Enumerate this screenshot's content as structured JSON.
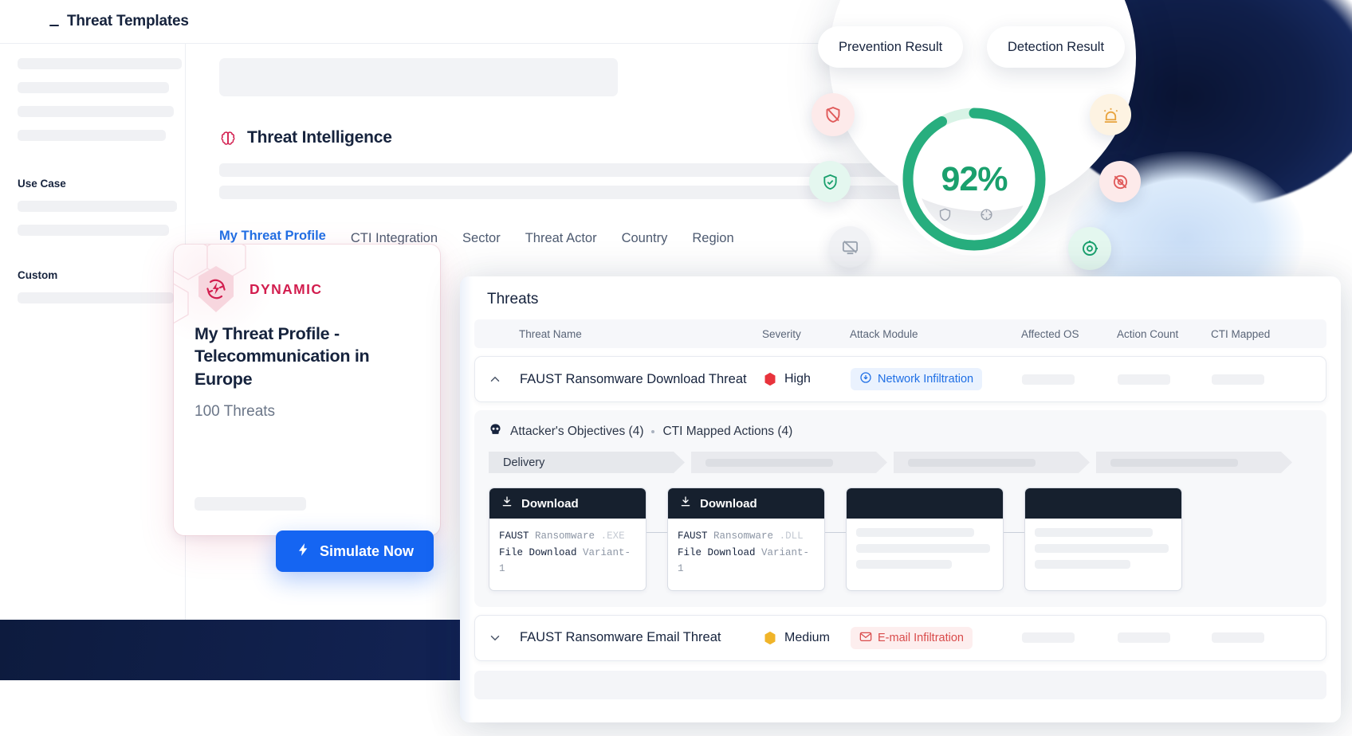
{
  "header": {
    "title": "Threat Templates"
  },
  "sidebar": {
    "sections": [
      {
        "label": "Use Case"
      },
      {
        "label": "Custom"
      }
    ]
  },
  "main": {
    "section_title": "Threat Intelligence",
    "section_icon": "brain-icon",
    "tabs": [
      {
        "label": "My Threat Profile",
        "active": true
      },
      {
        "label": "CTI Integration",
        "active": false
      },
      {
        "label": "Sector",
        "active": false
      },
      {
        "label": "Threat Actor",
        "active": false
      },
      {
        "label": "Country",
        "active": false
      },
      {
        "label": "Region",
        "active": false
      }
    ]
  },
  "profile_card": {
    "badge_label": "DYNAMIC",
    "badge_icon": "refresh-bolt-icon",
    "title": "My Threat Profile - Telecommunication in Europe",
    "subtitle": "100 Threats"
  },
  "simulate_button": {
    "label": "Simulate Now",
    "icon": "lightning-bolt-icon"
  },
  "gauge": {
    "value": "92%",
    "pills": [
      {
        "label": "Prevention Result"
      },
      {
        "label": "Detection Result"
      }
    ],
    "accent_color": "#1aa06d",
    "bubbles": [
      {
        "icon": "shield-off-icon",
        "color": "#e05a5a",
        "bg": "#fdeaea"
      },
      {
        "icon": "shield-check-icon",
        "color": "#1aa06d",
        "bg": "#e4f7ef"
      },
      {
        "icon": "alert-siren-icon",
        "color": "#e8a33d",
        "bg": "#fdf3e2"
      },
      {
        "icon": "target-off-icon",
        "color": "#e05a5a",
        "bg": "#fdeaea"
      },
      {
        "icon": "monitor-off-icon",
        "color": "#9aa3b0",
        "bg": "#f1f2f5"
      },
      {
        "icon": "target-check-icon",
        "color": "#1aa06d",
        "bg": "#e4f7ef"
      }
    ],
    "mini_icons": [
      {
        "icon": "shield-icon"
      },
      {
        "icon": "crosshair-icon"
      }
    ]
  },
  "threats": {
    "panel_title": "Threats",
    "columns": [
      "Threat Name",
      "Severity",
      "Attack Module",
      "Affected  OS",
      "Action Count",
      "CTI Mapped"
    ],
    "rows": [
      {
        "expanded": true,
        "name": "FAUST Ransomware Download Threat",
        "severity": "High",
        "severity_color": "#e8333c",
        "module": "Network Infiltration",
        "module_icon": "download-circle-icon",
        "module_style": "net"
      },
      {
        "expanded": false,
        "name": "FAUST Ransomware Email Threat",
        "severity": "Medium",
        "severity_color": "#f0b429",
        "module": "E-mail Infiltration",
        "module_icon": "mail-icon",
        "module_style": "mail"
      }
    ],
    "detail": {
      "objectives_label": "Attacker's Objectives (4)",
      "objectives_icon": "skull-icon",
      "mapped_label": "CTI Mapped Actions (4)",
      "stages": [
        "Delivery",
        "",
        "",
        ""
      ],
      "action_cards": [
        {
          "head": "Download",
          "head_icon": "download-icon",
          "line1_a": "FAUST",
          "line1_b": "Ransomware",
          "line1_c": ".EXE",
          "line2_a": "File Download",
          "line2_b": "Variant-1"
        },
        {
          "head": "Download",
          "head_icon": "download-icon",
          "line1_a": "FAUST",
          "line1_b": "Ransomware",
          "line1_c": ".DLL",
          "line2_a": "File Download",
          "line2_b": "Variant-1"
        },
        {
          "head": "",
          "head_icon": "download-icon"
        },
        {
          "head": "",
          "head_icon": "download-icon"
        }
      ]
    }
  }
}
